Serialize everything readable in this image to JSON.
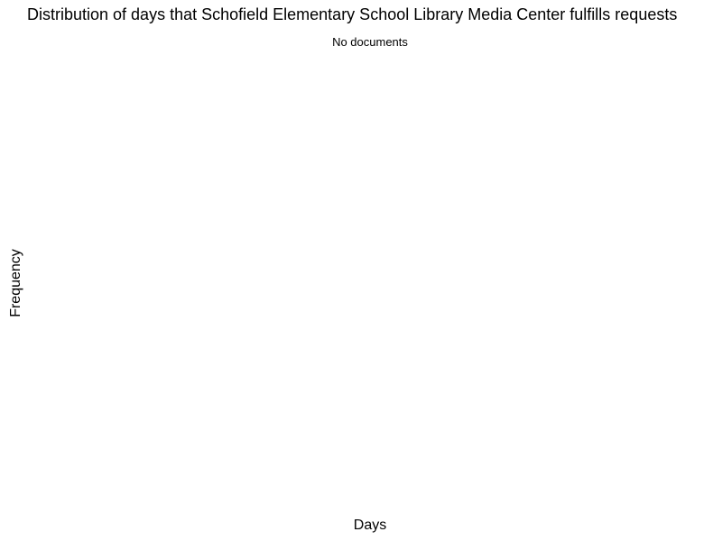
{
  "chart_data": {
    "type": "bar",
    "title": "Distribution of days that Schofield Elementary School Library Media Center fulfills requests",
    "subtitle": "No documents",
    "xlabel": "Days",
    "ylabel": "Frequency",
    "categories": [],
    "values": [],
    "grid": false,
    "legend": "none"
  }
}
